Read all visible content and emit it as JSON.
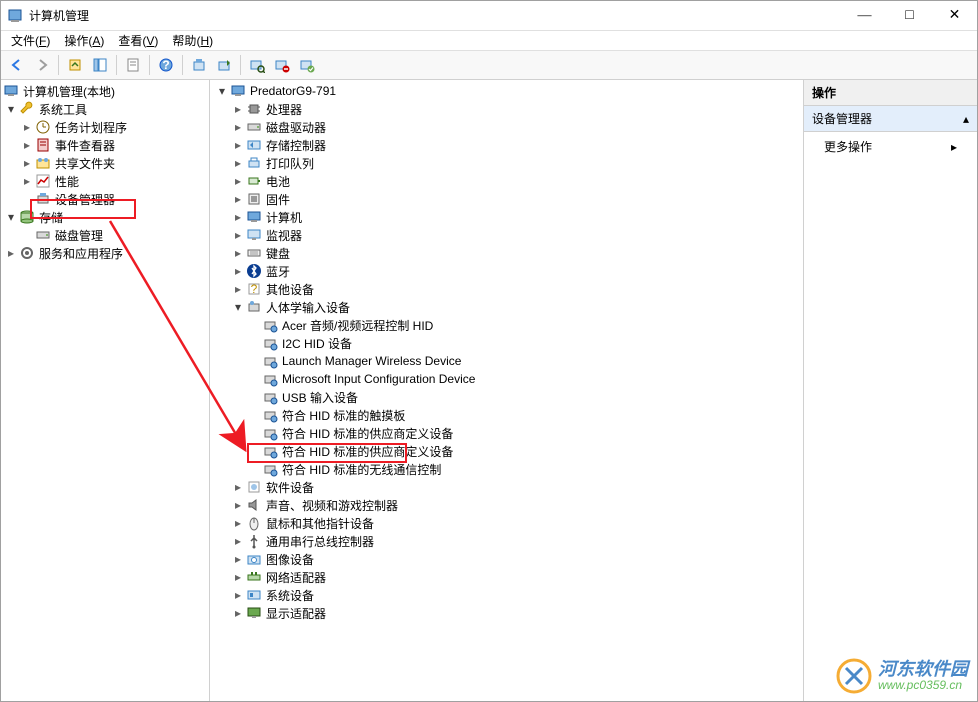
{
  "window": {
    "title": "计算机管理",
    "min": "—",
    "max": "□",
    "close": "✕"
  },
  "menubar": [
    {
      "label": "文件",
      "key": "F"
    },
    {
      "label": "操作",
      "key": "A"
    },
    {
      "label": "查看",
      "key": "V"
    },
    {
      "label": "帮助",
      "key": "H"
    }
  ],
  "left_tree": {
    "root": "计算机管理(本地)",
    "groups": [
      {
        "label": "系统工具",
        "icon": "wrench",
        "expanded": true,
        "children": [
          {
            "label": "任务计划程序",
            "icon": "clock",
            "has_children": true
          },
          {
            "label": "事件查看器",
            "icon": "event",
            "has_children": true
          },
          {
            "label": "共享文件夹",
            "icon": "share",
            "has_children": true
          },
          {
            "label": "性能",
            "icon": "perf",
            "has_children": true
          },
          {
            "label": "设备管理器",
            "icon": "device",
            "selected": true
          }
        ]
      },
      {
        "label": "存储",
        "icon": "storage",
        "expanded": true,
        "children": [
          {
            "label": "磁盘管理",
            "icon": "disk"
          }
        ]
      },
      {
        "label": "服务和应用程序",
        "icon": "services",
        "has_children": true
      }
    ]
  },
  "center_tree": {
    "root": "PredatorG9-791",
    "nodes": [
      {
        "label": "处理器",
        "icon": "cpu",
        "has_children": true
      },
      {
        "label": "磁盘驱动器",
        "icon": "disk-drive",
        "has_children": true
      },
      {
        "label": "存储控制器",
        "icon": "storage-ctrl",
        "has_children": true
      },
      {
        "label": "打印队列",
        "icon": "printer",
        "has_children": true
      },
      {
        "label": "电池",
        "icon": "battery",
        "has_children": true
      },
      {
        "label": "固件",
        "icon": "firmware",
        "has_children": true
      },
      {
        "label": "计算机",
        "icon": "computer",
        "has_children": true
      },
      {
        "label": "监视器",
        "icon": "monitor",
        "has_children": true
      },
      {
        "label": "键盘",
        "icon": "keyboard",
        "has_children": true
      },
      {
        "label": "蓝牙",
        "icon": "bluetooth",
        "has_children": true
      },
      {
        "label": "其他设备",
        "icon": "other",
        "has_children": true
      },
      {
        "label": "人体学输入设备",
        "icon": "hid",
        "expanded": true,
        "children": [
          {
            "label": "Acer 音频/视频远程控制 HID",
            "icon": "hid-dev"
          },
          {
            "label": "I2C HID 设备",
            "icon": "hid-dev"
          },
          {
            "label": "Launch Manager Wireless Device",
            "icon": "hid-dev"
          },
          {
            "label": "Microsoft Input Configuration Device",
            "icon": "hid-dev"
          },
          {
            "label": "USB 输入设备",
            "icon": "hid-dev"
          },
          {
            "label": "符合 HID 标准的触摸板",
            "icon": "hid-dev",
            "highlighted": true
          },
          {
            "label": "符合 HID 标准的供应商定义设备",
            "icon": "hid-dev"
          },
          {
            "label": "符合 HID 标准的供应商定义设备",
            "icon": "hid-dev"
          },
          {
            "label": "符合 HID 标准的无线通信控制",
            "icon": "hid-dev"
          }
        ]
      },
      {
        "label": "软件设备",
        "icon": "soft-dev",
        "has_children": true
      },
      {
        "label": "声音、视频和游戏控制器",
        "icon": "sound",
        "has_children": true
      },
      {
        "label": "鼠标和其他指针设备",
        "icon": "mouse",
        "has_children": true
      },
      {
        "label": "通用串行总线控制器",
        "icon": "usb",
        "has_children": true
      },
      {
        "label": "图像设备",
        "icon": "imaging",
        "has_children": true
      },
      {
        "label": "网络适配器",
        "icon": "network",
        "has_children": true
      },
      {
        "label": "系统设备",
        "icon": "system",
        "has_children": true
      },
      {
        "label": "显示适配器",
        "icon": "display",
        "has_children": true
      }
    ]
  },
  "right_pane": {
    "header": "操作",
    "section": "设备管理器",
    "more": "更多操作"
  },
  "watermark": {
    "cn": "河东软件园",
    "en": "www.pc0359.cn"
  }
}
